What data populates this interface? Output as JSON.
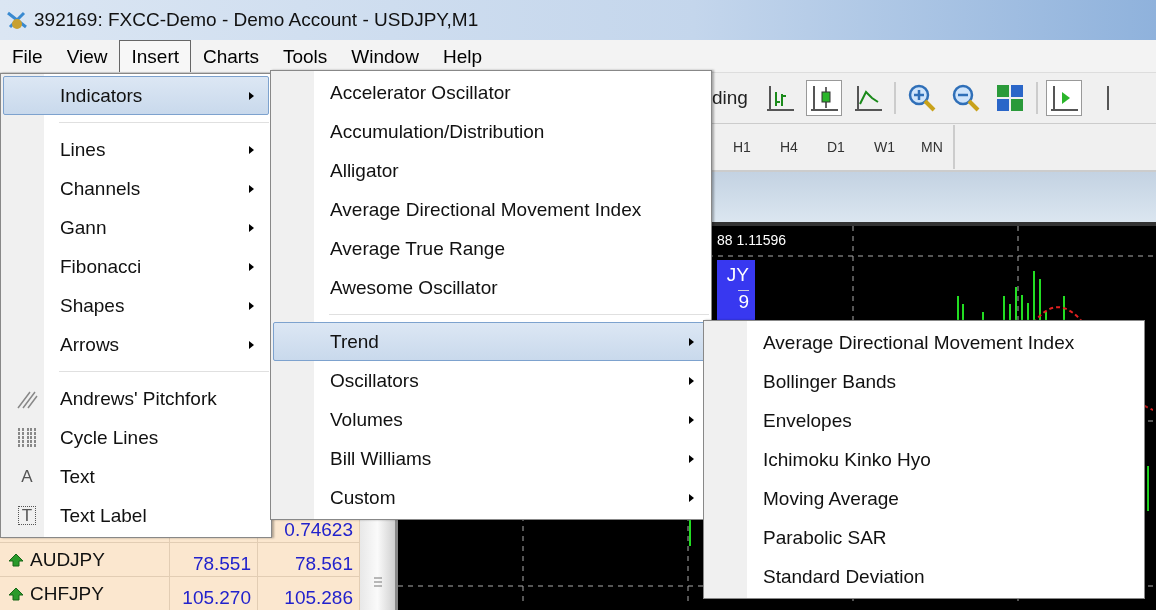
{
  "window": {
    "title": "392169: FXCC-Demo - Demo Account - USDJPY,M1"
  },
  "menu_bar": [
    {
      "label": "File",
      "selected": false
    },
    {
      "label": "View",
      "selected": false
    },
    {
      "label": "Insert",
      "selected": true
    },
    {
      "label": "Charts",
      "selected": false
    },
    {
      "label": "Tools",
      "selected": false
    },
    {
      "label": "Window",
      "selected": false
    },
    {
      "label": "Help",
      "selected": false
    }
  ],
  "toolbar": {
    "partial_label": "ding",
    "buttons": [
      {
        "kind": "bar-chart",
        "pressed": false
      },
      {
        "kind": "candlestick-chart",
        "pressed": true
      },
      {
        "kind": "line-chart",
        "pressed": false
      },
      {
        "kind": "separator"
      },
      {
        "kind": "zoom-in",
        "pressed": false
      },
      {
        "kind": "zoom-out",
        "pressed": false
      },
      {
        "kind": "tile-windows",
        "pressed": false
      },
      {
        "kind": "separator"
      },
      {
        "kind": "auto-scroll",
        "pressed": true
      },
      {
        "kind": "chart-shift",
        "pressed": false
      }
    ]
  },
  "timeframes": [
    "H1",
    "H4",
    "D1",
    "W1",
    "MN"
  ],
  "market_watch": {
    "rows": [
      {
        "symbol": "",
        "bid": "",
        "ask": "0.74623"
      },
      {
        "symbol": "AUDJPY",
        "bid": "78.551",
        "ask": "78.561",
        "trend_up": true
      },
      {
        "symbol": "CHFJPY",
        "bid": "105.270",
        "ask": "105.286",
        "trend_up": true
      }
    ]
  },
  "chart": {
    "price_label": "88 1.11596",
    "symbol_label": "JY",
    "value_label": "9"
  },
  "insert_menu": {
    "items": [
      {
        "kind": "item",
        "label": "Indicators",
        "submenu": true,
        "selected": true
      },
      {
        "kind": "separator"
      },
      {
        "kind": "item",
        "label": "Lines",
        "submenu": true,
        "selected": false
      },
      {
        "kind": "item",
        "label": "Channels",
        "submenu": true,
        "selected": false
      },
      {
        "kind": "item",
        "label": "Gann",
        "submenu": true,
        "selected": false
      },
      {
        "kind": "item",
        "label": "Fibonacci",
        "submenu": true,
        "selected": false
      },
      {
        "kind": "item",
        "label": "Shapes",
        "submenu": true,
        "selected": false
      },
      {
        "kind": "item",
        "label": "Arrows",
        "submenu": true,
        "selected": false
      },
      {
        "kind": "separator"
      },
      {
        "kind": "item",
        "label": "Andrews' Pitchfork",
        "submenu": false,
        "selected": false,
        "icon": {
          "kind": "pitchfork"
        }
      },
      {
        "kind": "item",
        "label": "Cycle Lines",
        "submenu": false,
        "selected": false,
        "icon": {
          "kind": "cycle-lines"
        }
      },
      {
        "kind": "item",
        "label": "Text",
        "submenu": false,
        "selected": false,
        "icon": {
          "kind": "glyph",
          "glyph": "A"
        }
      },
      {
        "kind": "item",
        "label": "Text Label",
        "submenu": false,
        "selected": false,
        "icon": {
          "kind": "boxed-glyph",
          "glyph": "T"
        }
      }
    ]
  },
  "indicators_menu": {
    "items": [
      {
        "kind": "item",
        "label": "Accelerator Oscillator",
        "submenu": false,
        "selected": false
      },
      {
        "kind": "item",
        "label": "Accumulation/Distribution",
        "submenu": false,
        "selected": false
      },
      {
        "kind": "item",
        "label": "Alligator",
        "submenu": false,
        "selected": false
      },
      {
        "kind": "item",
        "label": "Average Directional Movement Index",
        "submenu": false,
        "selected": false
      },
      {
        "kind": "item",
        "label": "Average True Range",
        "submenu": false,
        "selected": false
      },
      {
        "kind": "item",
        "label": "Awesome Oscillator",
        "submenu": false,
        "selected": false
      },
      {
        "kind": "separator"
      },
      {
        "kind": "item",
        "label": "Trend",
        "submenu": true,
        "selected": true
      },
      {
        "kind": "item",
        "label": "Oscillators",
        "submenu": true,
        "selected": false
      },
      {
        "kind": "item",
        "label": "Volumes",
        "submenu": true,
        "selected": false
      },
      {
        "kind": "item",
        "label": "Bill Williams",
        "submenu": true,
        "selected": false
      },
      {
        "kind": "item",
        "label": "Custom",
        "submenu": true,
        "selected": false
      }
    ]
  },
  "trend_menu": {
    "items": [
      {
        "kind": "item",
        "label": "Average Directional Movement Index",
        "submenu": false,
        "selected": false
      },
      {
        "kind": "item",
        "label": "Bollinger Bands",
        "submenu": false,
        "selected": false
      },
      {
        "kind": "item",
        "label": "Envelopes",
        "submenu": false,
        "selected": false
      },
      {
        "kind": "item",
        "label": "Ichimoku Kinko Hyo",
        "submenu": false,
        "selected": false
      },
      {
        "kind": "item",
        "label": "Moving Average",
        "submenu": false,
        "selected": false
      },
      {
        "kind": "item",
        "label": "Parabolic SAR",
        "submenu": false,
        "selected": false
      },
      {
        "kind": "item",
        "label": "Standard Deviation",
        "submenu": false,
        "selected": false
      }
    ]
  }
}
